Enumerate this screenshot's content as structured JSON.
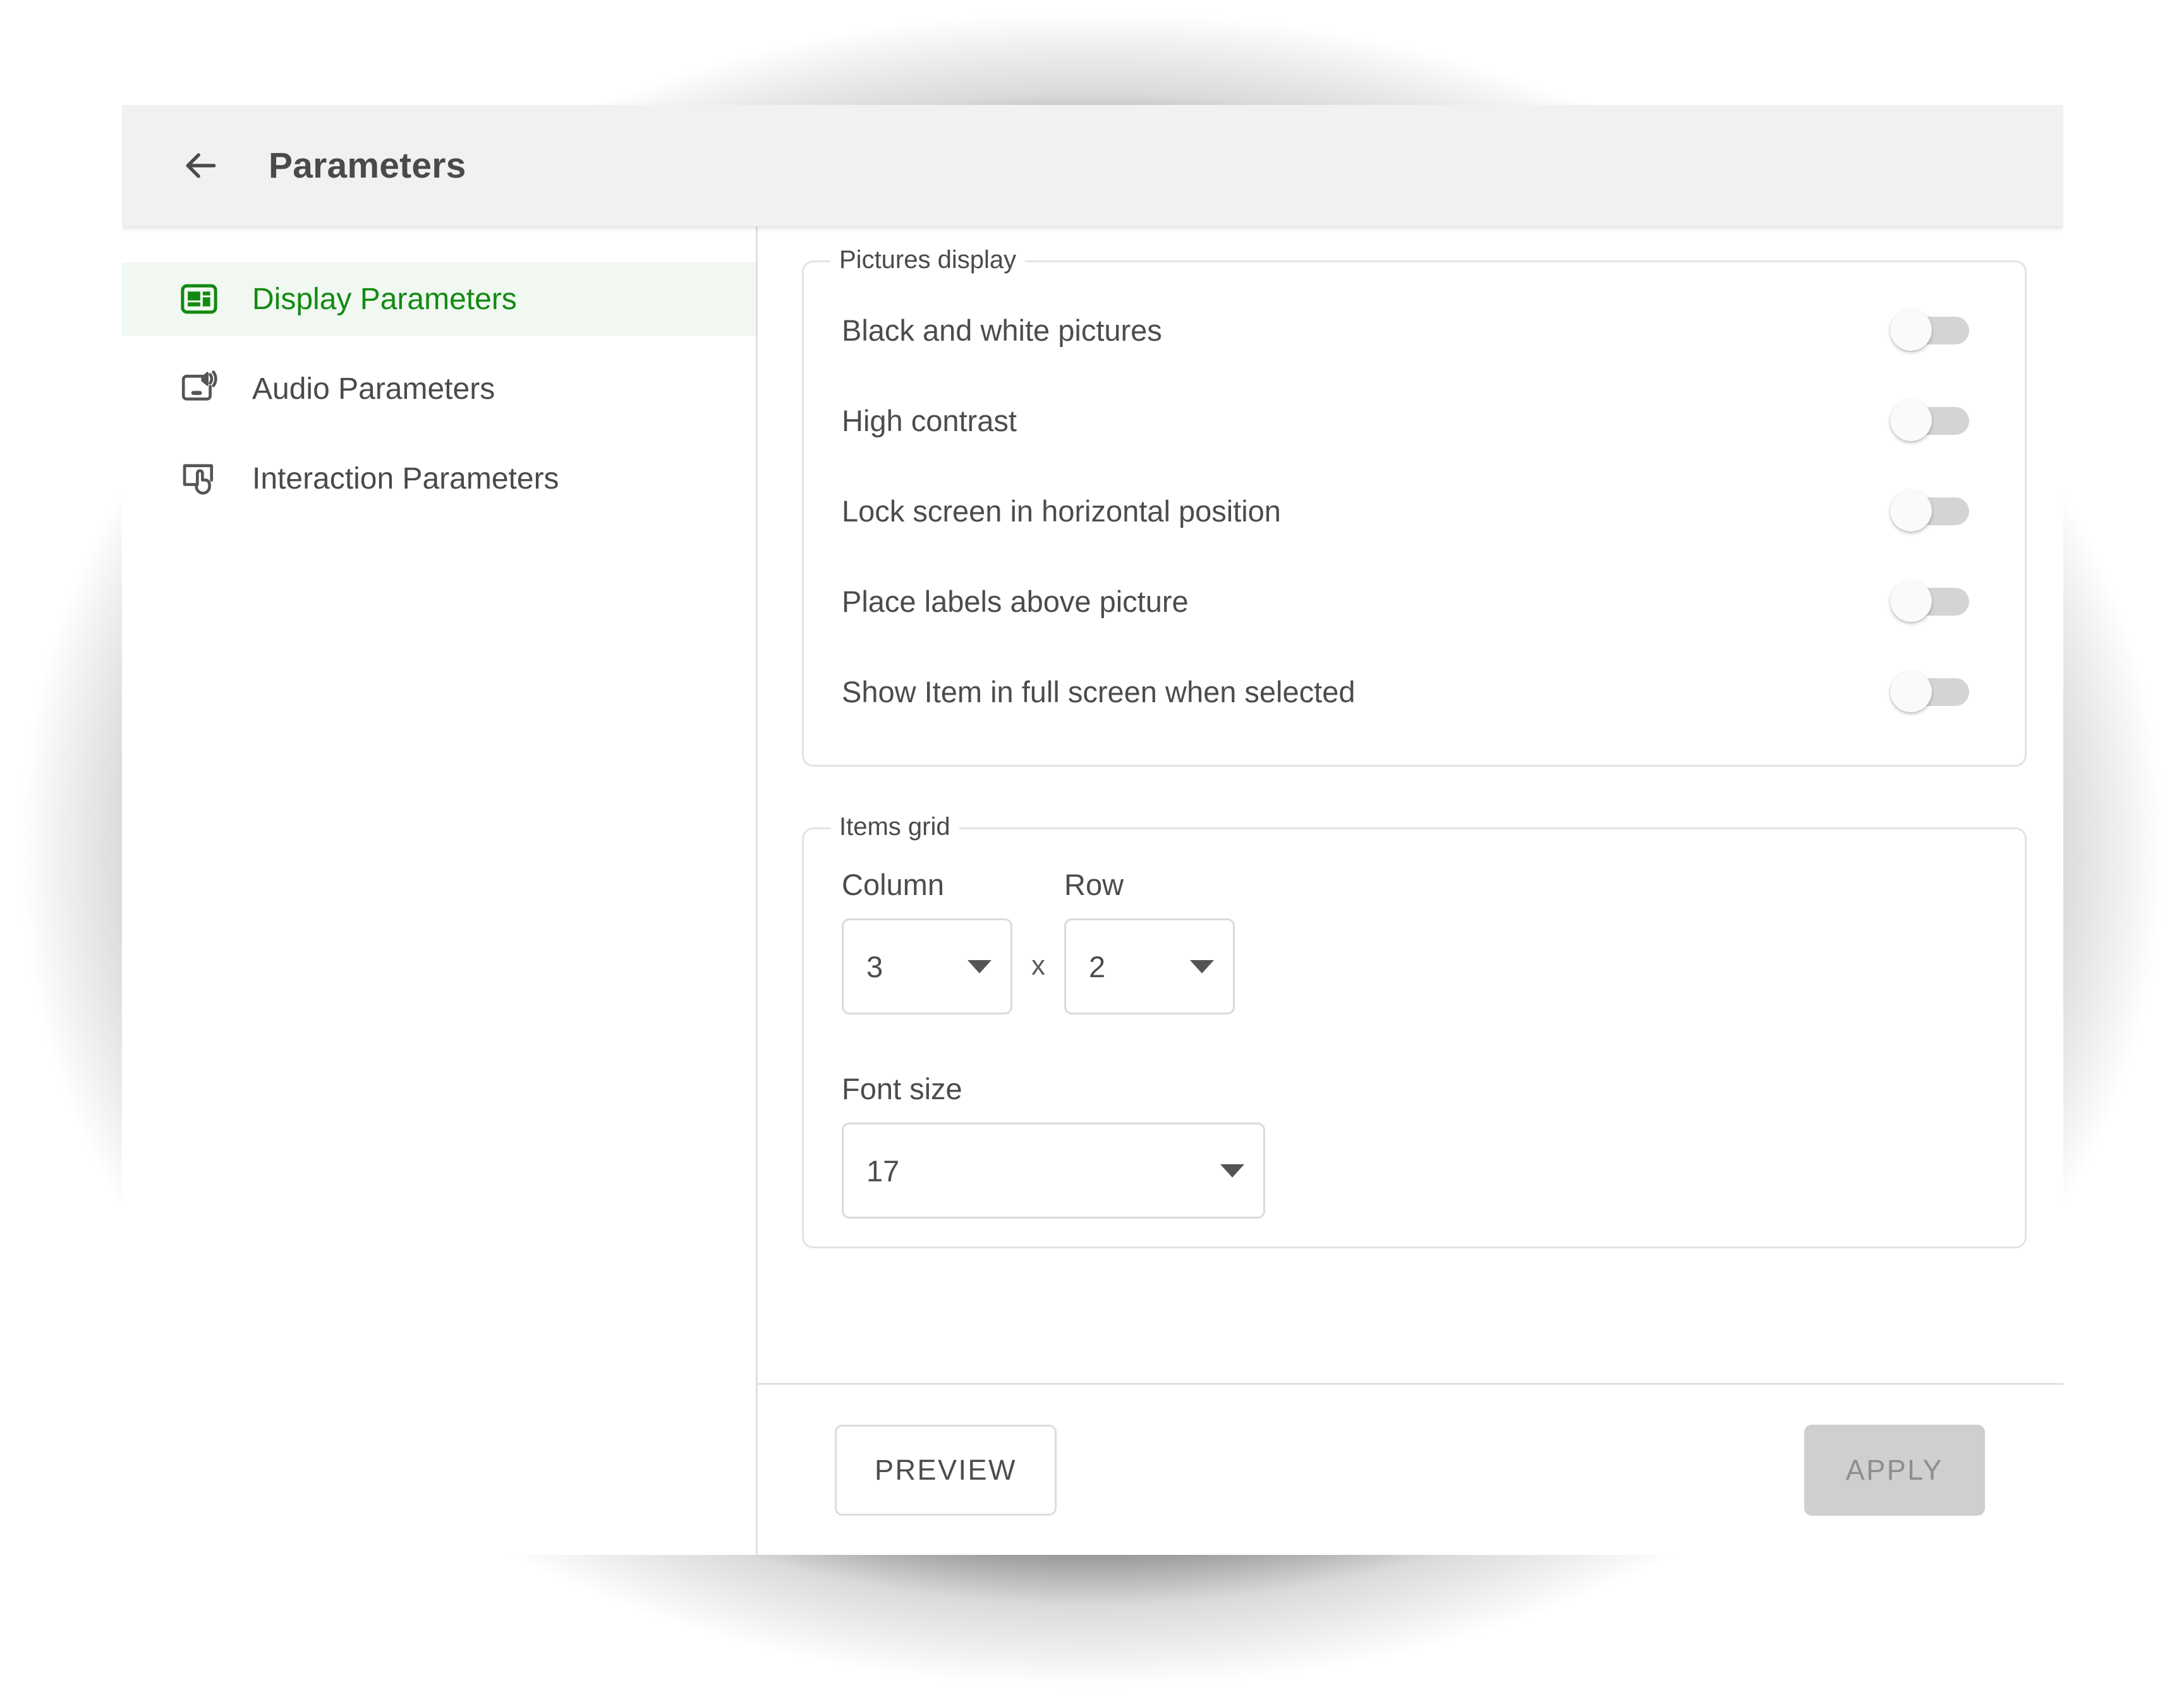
{
  "header": {
    "back_icon": "arrow-left-icon",
    "title": "Parameters"
  },
  "sidebar": {
    "items": [
      {
        "label": "Display Parameters",
        "icon": "display-layout-icon",
        "active": true
      },
      {
        "label": "Audio Parameters",
        "icon": "screen-speaker-icon",
        "active": false
      },
      {
        "label": "Interaction Parameters",
        "icon": "touch-screen-icon",
        "active": false
      }
    ]
  },
  "main": {
    "pictures_display": {
      "legend": "Pictures display",
      "toggles": [
        {
          "label": "Black and white pictures",
          "on": false
        },
        {
          "label": "High contrast",
          "on": false
        },
        {
          "label": "Lock screen in horizontal position",
          "on": false
        },
        {
          "label": "Place labels above picture",
          "on": false
        },
        {
          "label": "Show Item in full screen when selected",
          "on": false
        }
      ]
    },
    "items_grid": {
      "legend": "Items grid",
      "column_label": "Column",
      "column_value": "3",
      "separator": "x",
      "row_label": "Row",
      "row_value": "2",
      "font_size_label": "Font size",
      "font_size_value": "17"
    }
  },
  "footer": {
    "preview_label": "PREVIEW",
    "apply_label": "APPLY"
  },
  "colors": {
    "accent_green": "#128a12",
    "accent_green_bg": "#f1f8f1",
    "header_bg": "#f1f1f1",
    "text": "#4c4c4c",
    "border": "#e0e0e0",
    "toggle_track": "#d4d4d4",
    "apply_disabled_bg": "#cfcfcf",
    "apply_disabled_text": "#8e8e8e"
  }
}
